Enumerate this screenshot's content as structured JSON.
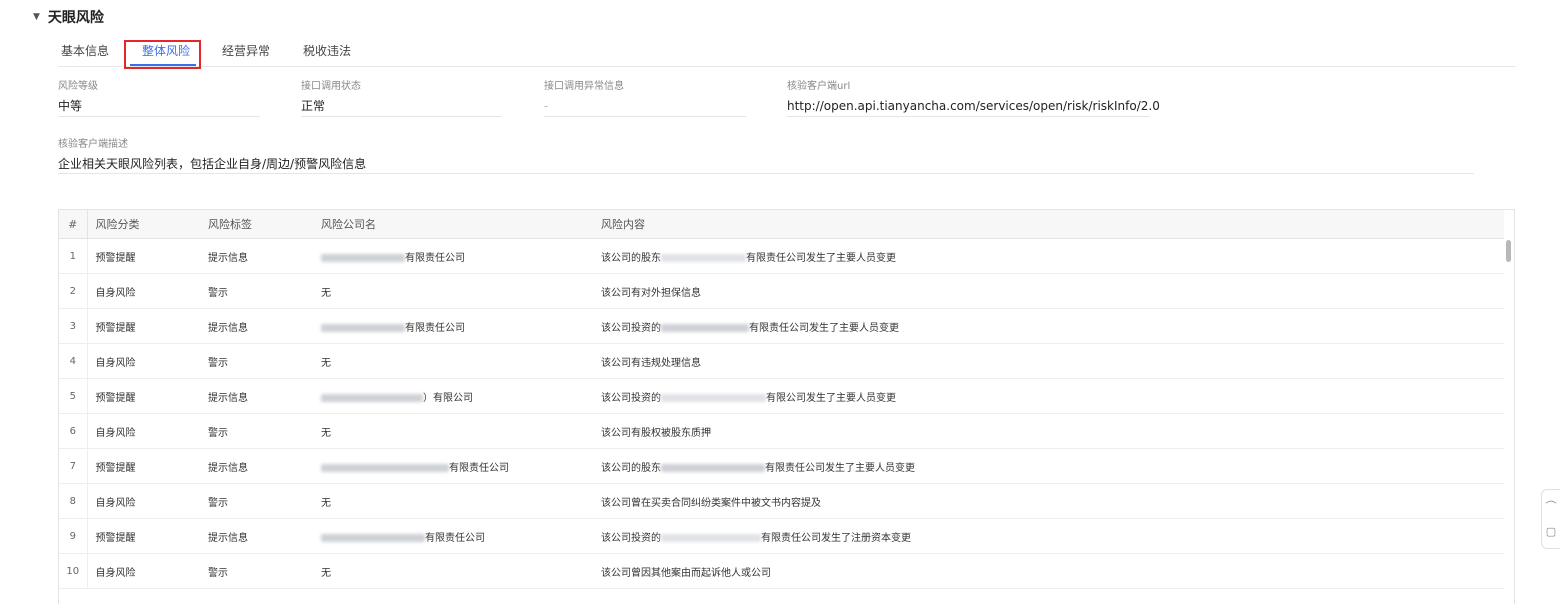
{
  "section": {
    "title": "天眼风险"
  },
  "tabs": [
    {
      "label": "基本信息"
    },
    {
      "label": "整体风险"
    },
    {
      "label": "经营异常"
    },
    {
      "label": "税收违法"
    }
  ],
  "fields": {
    "risk_level": {
      "label": "风险等级",
      "value": "中等"
    },
    "api_status": {
      "label": "接口调用状态",
      "value": "正常"
    },
    "api_error": {
      "label": "接口调用异常信息",
      "value": "-"
    },
    "client_url": {
      "label": "核验客户端url",
      "value": "http://open.api.tianyancha.com/services/open/risk/riskInfo/2.0"
    },
    "client_desc": {
      "label": "核验客户端描述",
      "value": "企业相关天眼风险列表，包括企业自身/周边/预警风险信息"
    }
  },
  "table": {
    "headers": {
      "idx": "#",
      "category": "风险分类",
      "tag": "风险标签",
      "company": "风险公司名",
      "content": "风险内容"
    },
    "rows": [
      {
        "idx": "1",
        "category": "预警提醒",
        "tag": "提示信息",
        "company_suffix": "有限责任公司",
        "content_prefix": "该公司的股东",
        "content_suffix": "有限责任公司发生了主要人员变更"
      },
      {
        "idx": "2",
        "category": "自身风险",
        "tag": "警示",
        "company": "无",
        "content": "该公司有对外担保信息"
      },
      {
        "idx": "3",
        "category": "预警提醒",
        "tag": "提示信息",
        "company_suffix": "有限责任公司",
        "content_prefix": "该公司投资的",
        "content_suffix": "有限责任公司发生了主要人员变更"
      },
      {
        "idx": "4",
        "category": "自身风险",
        "tag": "警示",
        "company": "无",
        "content": "该公司有违规处理信息"
      },
      {
        "idx": "5",
        "category": "预警提醒",
        "tag": "提示信息",
        "company_suffix": "）有限公司",
        "content_prefix": "该公司投资的",
        "content_suffix": "有限公司发生了主要人员变更"
      },
      {
        "idx": "6",
        "category": "自身风险",
        "tag": "警示",
        "company": "无",
        "content": "该公司有股权被股东质押"
      },
      {
        "idx": "7",
        "category": "预警提醒",
        "tag": "提示信息",
        "company_suffix": "有限责任公司",
        "content_prefix": "该公司的股东",
        "content_suffix": "有限责任公司发生了主要人员变更"
      },
      {
        "idx": "8",
        "category": "自身风险",
        "tag": "警示",
        "company": "无",
        "content": "该公司曾在买卖合同纠纷类案件中被文书内容提及"
      },
      {
        "idx": "9",
        "category": "预警提醒",
        "tag": "提示信息",
        "company_suffix": "有限责任公司",
        "content_prefix": "该公司投资的",
        "content_suffix": "有限责任公司发生了注册资本变更"
      },
      {
        "idx": "10",
        "category": "自身风险",
        "tag": "警示",
        "company": "无",
        "content": "该公司曾因其他案由而起诉他人或公司"
      }
    ]
  },
  "colors": {
    "accent": "#3d6ee8",
    "highlight": "#e5262b"
  },
  "icons": {
    "caret": "caret-down-icon",
    "feedback": "feedback-icon",
    "chat": "chat-icon"
  }
}
